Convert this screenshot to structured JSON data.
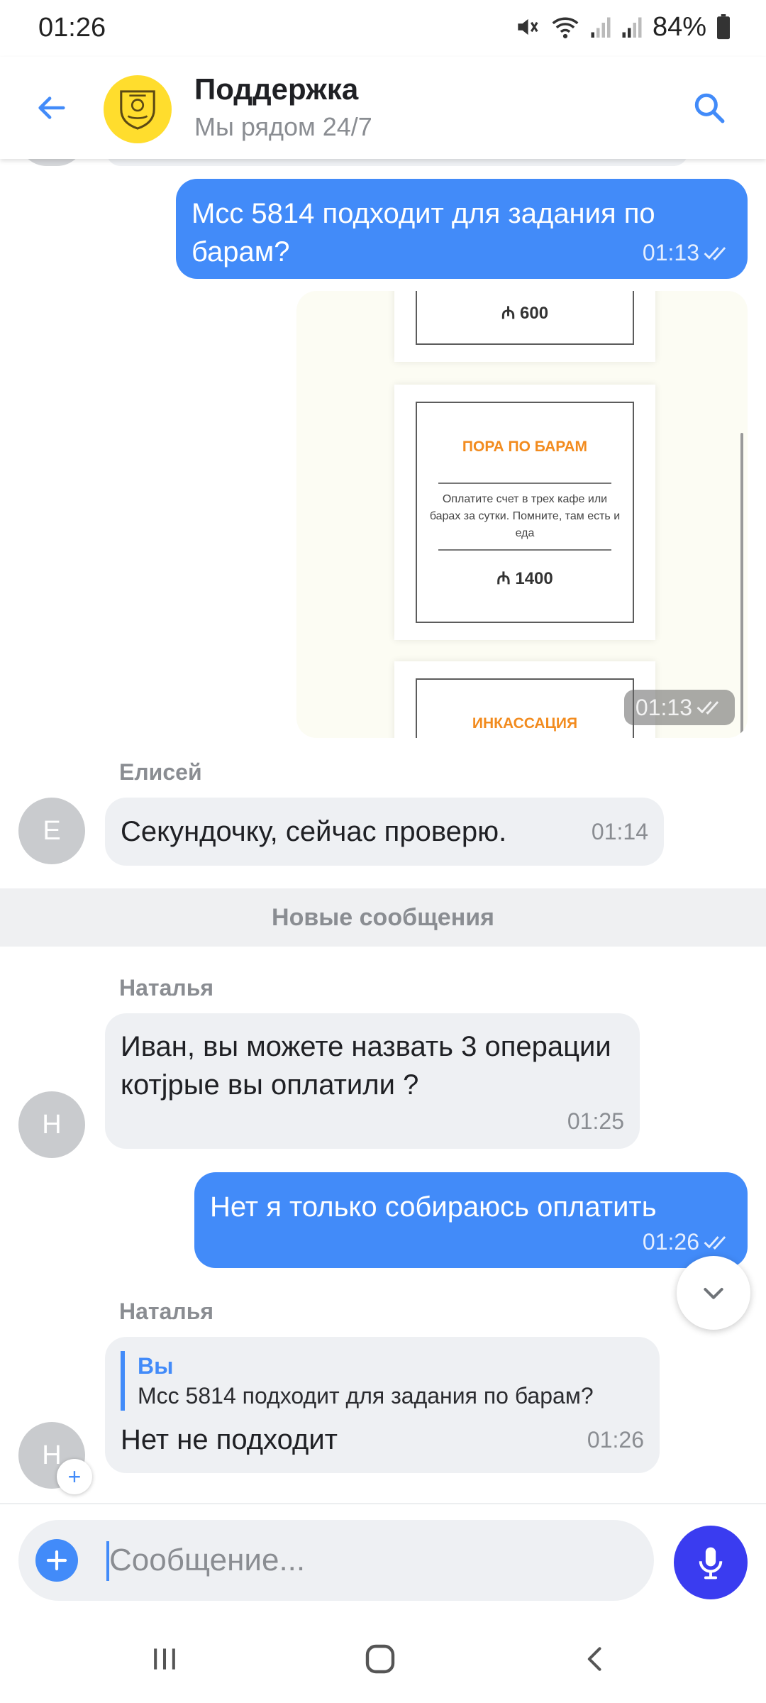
{
  "status_bar": {
    "time": "01:26",
    "battery": "84%",
    "icons": [
      "mute-icon",
      "wifi-icon",
      "signal-icon",
      "signal-icon",
      "battery-icon"
    ]
  },
  "header": {
    "title": "Поддержка",
    "subtitle": "Мы рядом 24/7",
    "back_icon": "back-arrow-icon",
    "search_icon": "search-icon",
    "accent": "#428bf9",
    "logo_color": "#ffdd2d"
  },
  "messages": {
    "m1": {
      "text": "Mcc 5814 подходит для задания по барам?",
      "time": "01:13",
      "status": "read"
    },
    "image": {
      "time": "01:13",
      "cards": {
        "top": {
          "price": "600"
        },
        "middle": {
          "title": "ПОРА ПО БАРАМ",
          "desc": "Оплатите счет в трех кафе или барах за сутки. Помните, там есть и еда",
          "price": "1400"
        },
        "bottom": {
          "title": "ИНКАССАЦИЯ"
        }
      }
    },
    "m2": {
      "sender": "Елисей",
      "avatar": "Е",
      "text": "Секундочку, сейчас проверю.",
      "time": "01:14"
    },
    "divider": "Новые сообщения",
    "m3": {
      "sender": "Наталья",
      "avatar": "Н",
      "text": "Иван, вы можете назвать 3 операции котјрые вы оплатили ?",
      "time": "01:25"
    },
    "m4": {
      "text": "Нет я только собираюсь оплатить",
      "time": "01:26",
      "status": "read"
    },
    "m5": {
      "sender": "Наталья",
      "avatar": "Н",
      "reply_author": "Вы",
      "reply_text": "Mcc 5814 подходит для задания по барам?",
      "text": "Нет не подходит",
      "time": "01:26"
    }
  },
  "composer": {
    "placeholder": "Сообщение...",
    "attach_icon": "plus-icon",
    "mic_icon": "microphone-icon",
    "mic_color": "#3a3cf0"
  },
  "nav_bar": {
    "icons": [
      "recent-apps-icon",
      "home-icon",
      "back-icon"
    ]
  }
}
